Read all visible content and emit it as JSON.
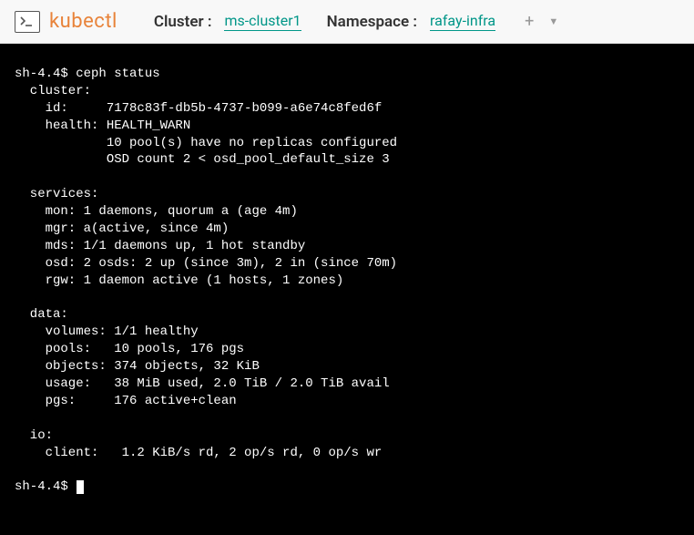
{
  "header": {
    "brand": "kubectl",
    "cluster_label": "Cluster :",
    "cluster_value": "ms-cluster1",
    "namespace_label": "Namespace :",
    "namespace_value": "rafay-infra"
  },
  "terminal": {
    "prompt1": "sh-4.4$ ceph status",
    "l01": "  cluster:",
    "l02": "    id:     7178c83f-db5b-4737-b099-a6e74c8fed6f",
    "l03": "    health: HEALTH_WARN",
    "l04": "            10 pool(s) have no replicas configured",
    "l05": "            OSD count 2 < osd_pool_default_size 3",
    "l06": " ",
    "l07": "  services:",
    "l08": "    mon: 1 daemons, quorum a (age 4m)",
    "l09": "    mgr: a(active, since 4m)",
    "l10": "    mds: 1/1 daemons up, 1 hot standby",
    "l11": "    osd: 2 osds: 2 up (since 3m), 2 in (since 70m)",
    "l12": "    rgw: 1 daemon active (1 hosts, 1 zones)",
    "l13": " ",
    "l14": "  data:",
    "l15": "    volumes: 1/1 healthy",
    "l16": "    pools:   10 pools, 176 pgs",
    "l17": "    objects: 374 objects, 32 KiB",
    "l18": "    usage:   38 MiB used, 2.0 TiB / 2.0 TiB avail",
    "l19": "    pgs:     176 active+clean",
    "l20": " ",
    "l21": "  io:",
    "l22": "    client:   1.2 KiB/s rd, 2 op/s rd, 0 op/s wr",
    "l23": " ",
    "prompt2": "sh-4.4$ "
  }
}
